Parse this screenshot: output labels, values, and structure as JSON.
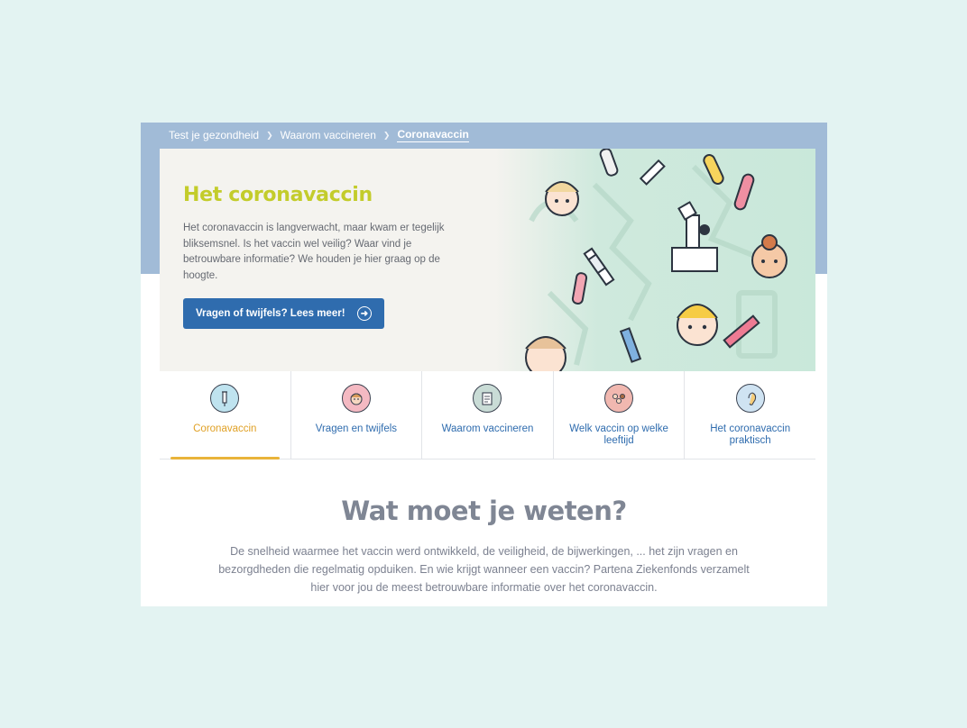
{
  "breadcrumb": {
    "items": [
      {
        "label": "Test je gezondheid"
      },
      {
        "label": "Waarom vaccineren"
      },
      {
        "label": "Coronavaccin"
      }
    ]
  },
  "hero": {
    "title": "Het coronavaccin",
    "text": "Het coronavaccin is langverwacht, maar kwam er tegelijk bliksemsnel. Is het vaccin wel veilig? Waar vind je betrouwbare informatie? We houden je hier graag op de hoogte.",
    "cta_label": "Vragen of twijfels? Lees meer!"
  },
  "tabs": [
    {
      "label": "Coronavaccin",
      "icon": "syringe-icon",
      "active": true
    },
    {
      "label": "Vragen en twijfels",
      "icon": "worried-face-icon",
      "active": false
    },
    {
      "label": "Waarom vaccineren",
      "icon": "clipboard-icon",
      "active": false
    },
    {
      "label": "Welk vaccin op welke leeftijd",
      "icon": "family-icon",
      "active": false
    },
    {
      "label": "Het coronavaccin praktisch",
      "icon": "ear-icon",
      "active": false
    }
  ],
  "section": {
    "title": "Wat moet je weten?",
    "text": "De snelheid waarmee het vaccin werd ontwikkeld, de veiligheid, de bijwerkingen, ... het zijn vragen en bezorgdheden die regelmatig opduiken. En wie krijgt wanneer een vaccin? Partena Ziekenfonds verzamelt hier voor jou de meest betrouwbare informatie over het coronavaccin."
  },
  "colors": {
    "page_bg": "#e3f3f2",
    "band": "#a1bbd7",
    "title_green": "#c3cc2b",
    "button_blue": "#2f6cae",
    "active_tab": "#e0a126",
    "illustration_bg": "#cde9dc"
  }
}
